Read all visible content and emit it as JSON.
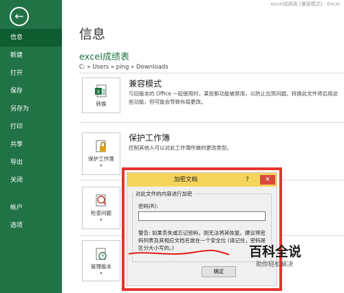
{
  "window": {
    "title": "excel成绩表 [兼容模式] - Excel"
  },
  "sidebar": {
    "items": [
      {
        "label": "信息"
      },
      {
        "label": "新建"
      },
      {
        "label": "打开"
      },
      {
        "label": "保存"
      },
      {
        "label": "另存为"
      },
      {
        "label": "打印"
      },
      {
        "label": "共享"
      },
      {
        "label": "导出"
      },
      {
        "label": "关闭"
      },
      {
        "label": "帐户"
      },
      {
        "label": "选项"
      }
    ],
    "active_index": 0
  },
  "main": {
    "page_title": "信息",
    "file_name": "excel成绩表",
    "file_path": "C: » Users » ping » Downloads",
    "sections": [
      {
        "tile_label": "转换",
        "title": "兼容模式",
        "description": "与旧版本的 Office 一起使用时，某些新功能被禁用，以防止出现问题。转换此文件将启用这些功能，但可能会导致布局更改。"
      },
      {
        "tile_label": "保护工作簿",
        "title": "保护工作簿",
        "description": "控制其他人可以对此工作簿所做的更改类型。"
      },
      {
        "tile_label": "检查问题"
      },
      {
        "tile_label": "管理版本"
      }
    ]
  },
  "dialog": {
    "title": "加密文档",
    "help": "?",
    "close": "✕",
    "group_legend": "对此文件的内容进行加密",
    "password_label": "密码(R):",
    "password_value": "",
    "warning": "警告: 如果丢失或忘记密码，则无法将其恢复。建议将密码列表及其相应文档名放在一个安全位 (请记住，密码是区分大小写的。)",
    "ok_label": "确定"
  },
  "watermark": {
    "main": "百科全说",
    "sub": "助你轻松解决"
  },
  "colors": {
    "accent": "#217346",
    "highlight_frame": "#e8332e",
    "dialog_titlebar": "#f5d45c"
  }
}
